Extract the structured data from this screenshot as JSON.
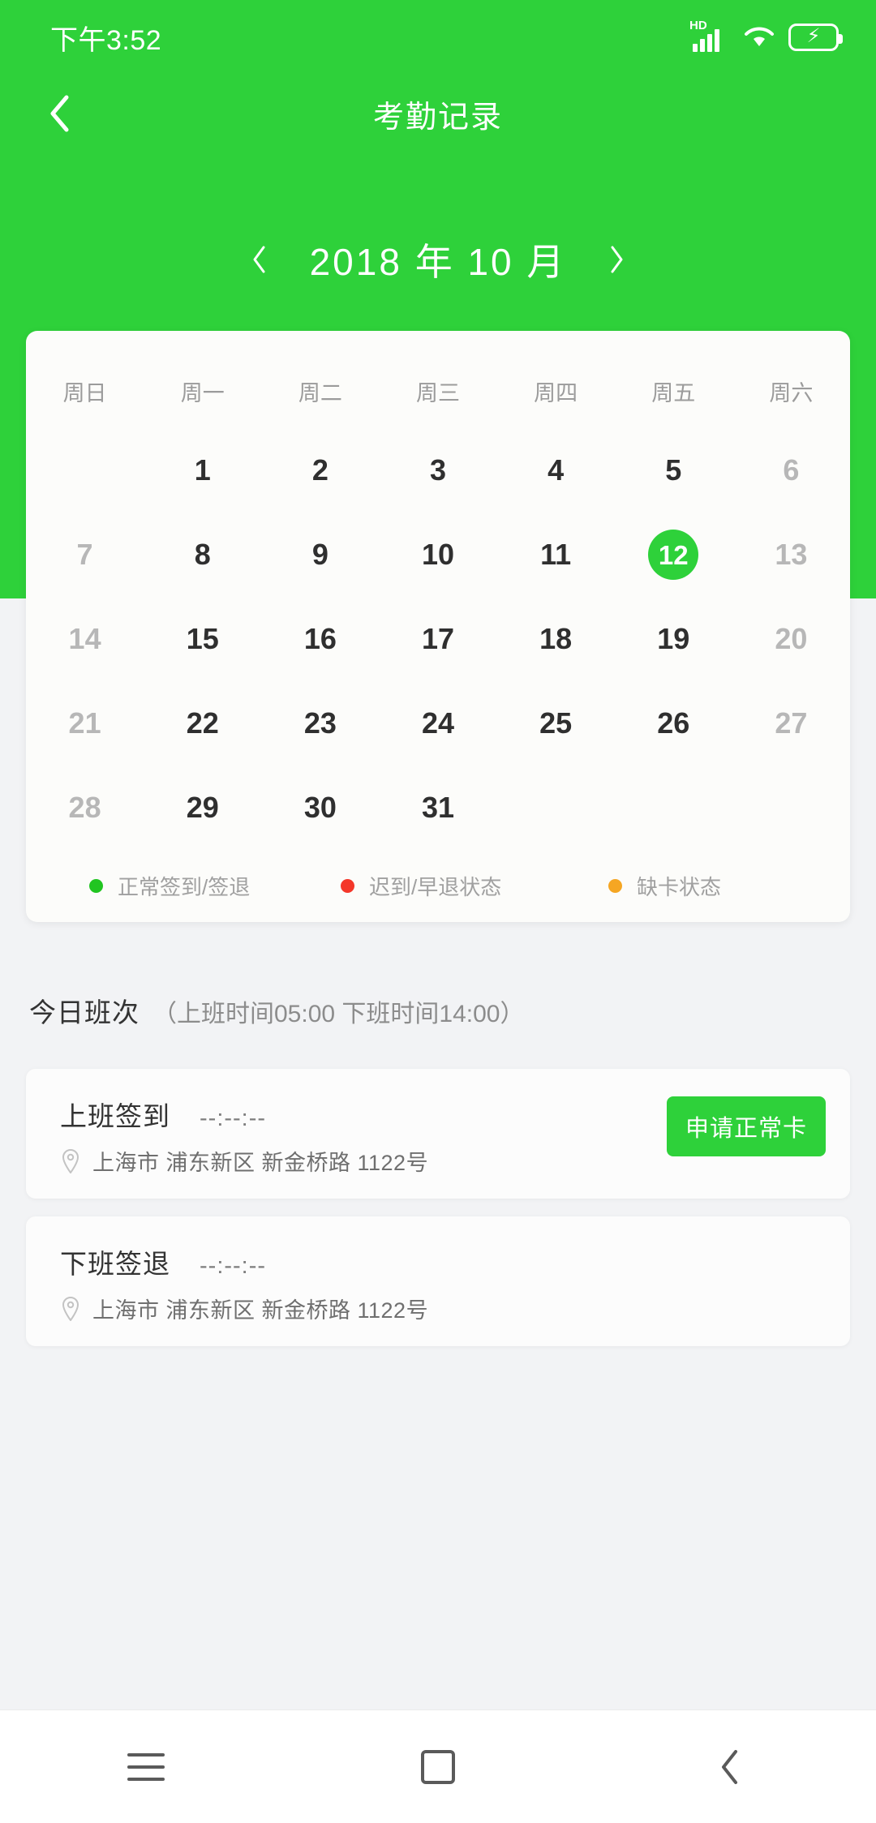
{
  "status_bar": {
    "time": "下午3:52",
    "hd_label": "HD",
    "icons": [
      "hd-signal-icon",
      "wifi-icon",
      "battery-charging-icon"
    ]
  },
  "navbar": {
    "back_icon": "chevron-left-icon",
    "title": "考勤记录"
  },
  "month_switch": {
    "prev_icon": "chevron-left-icon",
    "next_icon": "chevron-right-icon",
    "label": "2018 年 10 月"
  },
  "calendar": {
    "weekdays": [
      "周日",
      "周一",
      "周二",
      "周三",
      "周四",
      "周五",
      "周六"
    ],
    "weeks": [
      [
        {
          "label": "",
          "type": "empty"
        },
        {
          "label": "1",
          "type": "normal"
        },
        {
          "label": "2",
          "type": "normal"
        },
        {
          "label": "3",
          "type": "normal"
        },
        {
          "label": "4",
          "type": "normal"
        },
        {
          "label": "5",
          "type": "normal"
        },
        {
          "label": "6",
          "type": "muted"
        }
      ],
      [
        {
          "label": "7",
          "type": "muted"
        },
        {
          "label": "8",
          "type": "normal"
        },
        {
          "label": "9",
          "type": "normal"
        },
        {
          "label": "10",
          "type": "normal"
        },
        {
          "label": "11",
          "type": "normal"
        },
        {
          "label": "12",
          "type": "today"
        },
        {
          "label": "13",
          "type": "muted"
        }
      ],
      [
        {
          "label": "14",
          "type": "muted"
        },
        {
          "label": "15",
          "type": "normal"
        },
        {
          "label": "16",
          "type": "normal"
        },
        {
          "label": "17",
          "type": "normal"
        },
        {
          "label": "18",
          "type": "normal"
        },
        {
          "label": "19",
          "type": "normal"
        },
        {
          "label": "20",
          "type": "muted"
        }
      ],
      [
        {
          "label": "21",
          "type": "muted"
        },
        {
          "label": "22",
          "type": "normal"
        },
        {
          "label": "23",
          "type": "normal"
        },
        {
          "label": "24",
          "type": "normal"
        },
        {
          "label": "25",
          "type": "normal"
        },
        {
          "label": "26",
          "type": "normal"
        },
        {
          "label": "27",
          "type": "muted"
        }
      ],
      [
        {
          "label": "28",
          "type": "muted"
        },
        {
          "label": "29",
          "type": "normal"
        },
        {
          "label": "30",
          "type": "normal"
        },
        {
          "label": "31",
          "type": "normal"
        },
        {
          "label": "",
          "type": "empty"
        },
        {
          "label": "",
          "type": "empty"
        },
        {
          "label": "",
          "type": "empty"
        }
      ]
    ],
    "legend": [
      {
        "text": "正常签到/签退",
        "color": "#21c521"
      },
      {
        "text": "迟到/早退状态",
        "color": "#f4372a"
      },
      {
        "text": "缺卡状态",
        "color": "#f5a623"
      }
    ]
  },
  "shift": {
    "title": "今日班次",
    "detail": "（上班时间05:00  下班时间14:00）"
  },
  "punches": [
    {
      "label": "上班签到",
      "time": "--:--:--",
      "location": "上海市  浦东新区  新金桥路  1122号",
      "location_icon": "location-pin-icon",
      "button": "申请正常卡",
      "has_button": true
    },
    {
      "label": "下班签退",
      "time": "--:--:--",
      "location": "上海市  浦东新区  新金桥路  1122号",
      "location_icon": "location-pin-icon",
      "button": "",
      "has_button": false
    }
  ],
  "bottom_nav": [
    {
      "icon": "menu-icon"
    },
    {
      "icon": "home-square-icon"
    },
    {
      "icon": "back-chevron-icon"
    }
  ],
  "colors": {
    "brand_green": "#2ed13a",
    "page_bg": "#f2f3f5",
    "card_bg": "#fcfcfa"
  }
}
